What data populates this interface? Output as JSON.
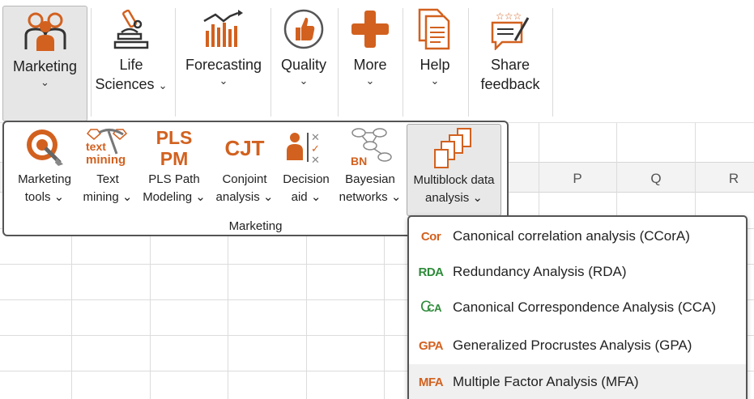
{
  "ribbon": {
    "items": [
      {
        "label": "Marketing",
        "chevron": "⌄"
      },
      {
        "label_line1": "Life",
        "label_line2": "Sciences",
        "chevron": "⌄"
      },
      {
        "label": "Forecasting",
        "chevron": "⌄"
      },
      {
        "label": "Quality",
        "chevron": "⌄"
      },
      {
        "label": "More",
        "chevron": "⌄"
      },
      {
        "label": "Help",
        "chevron": "⌄"
      },
      {
        "label_line1": "Share",
        "label_line2": "feedback"
      }
    ]
  },
  "sheet": {
    "columns": [
      "P",
      "Q",
      "R"
    ]
  },
  "marketing_panel": {
    "group_label": "Marketing",
    "tools": [
      {
        "line1": "Marketing",
        "line2": "tools",
        "chevron": "⌄"
      },
      {
        "line1": "Text",
        "line2": "mining",
        "chevron": "⌄",
        "icon_text1": "text",
        "icon_text2": "mining"
      },
      {
        "line1": "PLS Path",
        "line2": "Modeling",
        "chevron": "⌄",
        "icon_text1": "PLS",
        "icon_text2": "PM"
      },
      {
        "line1": "Conjoint",
        "line2": "analysis",
        "chevron": "⌄",
        "icon_text1": "CJT"
      },
      {
        "line1": "Decision",
        "line2": "aid",
        "chevron": "⌄"
      },
      {
        "line1": "Bayesian",
        "line2": "networks",
        "chevron": "⌄",
        "icon_text1": "BN"
      },
      {
        "line1": "Multiblock data",
        "line2": "analysis",
        "chevron": "⌄"
      }
    ]
  },
  "submenu": {
    "items": [
      {
        "badge": "Cor",
        "label": "Canonical correlation analysis (CCorA)",
        "color": "#d2611f"
      },
      {
        "badge": "RDA",
        "label": "Redundancy Analysis (RDA)",
        "color": "#2e8b3a"
      },
      {
        "badge": "CA",
        "label": "Canonical Correspondence Analysis (CCA)",
        "color": "#2e8b3a"
      },
      {
        "badge": "GPA",
        "label": "Generalized Procrustes Analysis (GPA)",
        "color": "#d2611f"
      },
      {
        "badge": "MFA",
        "label": "Multiple Factor Analysis (MFA)",
        "color": "#d2611f"
      }
    ]
  },
  "colors": {
    "accent": "#d2611f",
    "green": "#2e8b3a"
  }
}
